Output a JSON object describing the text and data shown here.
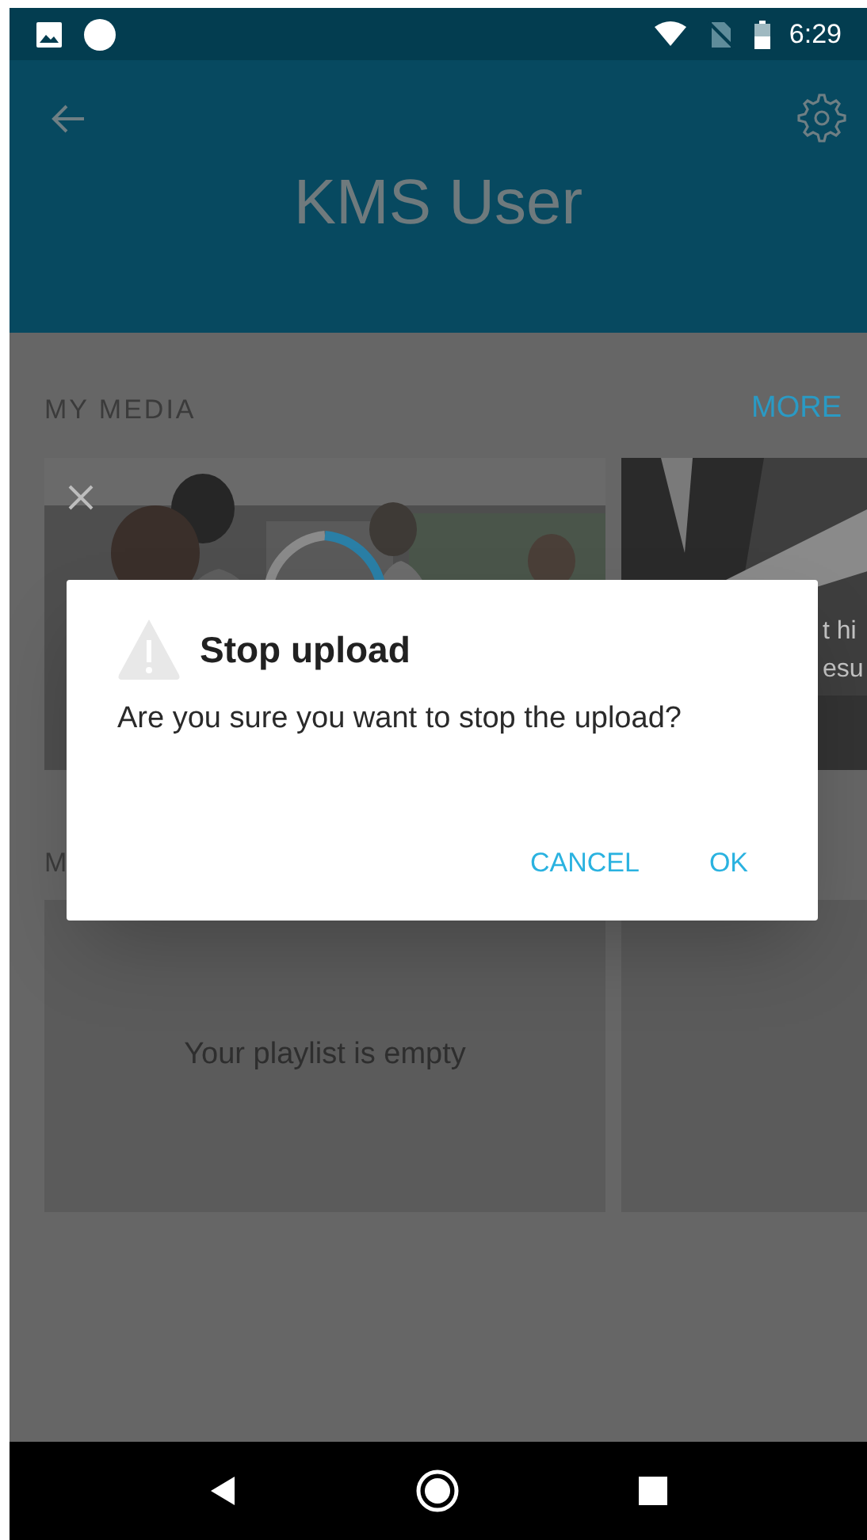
{
  "status_bar": {
    "time": "6:29"
  },
  "header": {
    "title": "KMS User"
  },
  "my_media": {
    "title": "MY MEDIA",
    "more": "MORE",
    "items": [
      {
        "kind": "uploading"
      },
      {
        "kind": "video",
        "caption_lines": [
          "t hi",
          "esu"
        ]
      }
    ]
  },
  "playlists": {
    "title": "M",
    "cards": [
      {
        "kind": "message",
        "text": "Your playlist is empty"
      },
      {
        "kind": "blank"
      }
    ]
  },
  "dialog": {
    "title": "Stop upload",
    "message": "Are you sure you want to stop the upload?",
    "buttons": [
      "CANCEL",
      "OK"
    ]
  }
}
